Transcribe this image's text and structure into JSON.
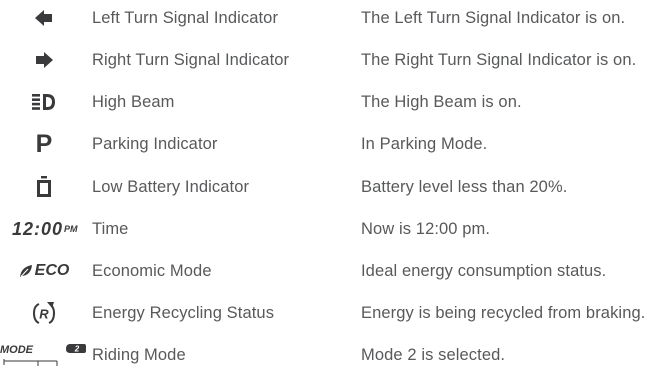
{
  "rows": [
    {
      "icon": "left-arrow-icon",
      "name": "Left Turn Signal Indicator",
      "description": "The Left Turn Signal Indicator is on."
    },
    {
      "icon": "right-arrow-icon",
      "name": "Right Turn Signal Indicator",
      "description": "The Right Turn Signal Indicator is on."
    },
    {
      "icon": "high-beam-icon",
      "name": "High Beam",
      "description": "The High Beam is on."
    },
    {
      "icon": "parking-icon",
      "icon_text": "P",
      "name": "Parking Indicator",
      "description": "In Parking Mode."
    },
    {
      "icon": "low-battery-icon",
      "name": "Low Battery Indicator",
      "description": "Battery level less than 20%."
    },
    {
      "icon": "time-display-icon",
      "icon_text": "12:00",
      "icon_suffix": "PM",
      "name": "Time",
      "description": "Now is 12:00 pm."
    },
    {
      "icon": "eco-leaf-icon",
      "icon_text": "ECO",
      "name": "Economic Mode",
      "description": "Ideal energy consumption status."
    },
    {
      "icon": "energy-recycling-icon",
      "icon_text": "R",
      "name": "Energy Recycling Status",
      "description": "Energy is being recycled from braking."
    },
    {
      "icon": "riding-mode-icon",
      "icon_text": "MODE",
      "icon_badge": "2",
      "name": "Riding Mode",
      "description": "Mode 2 is selected."
    }
  ]
}
